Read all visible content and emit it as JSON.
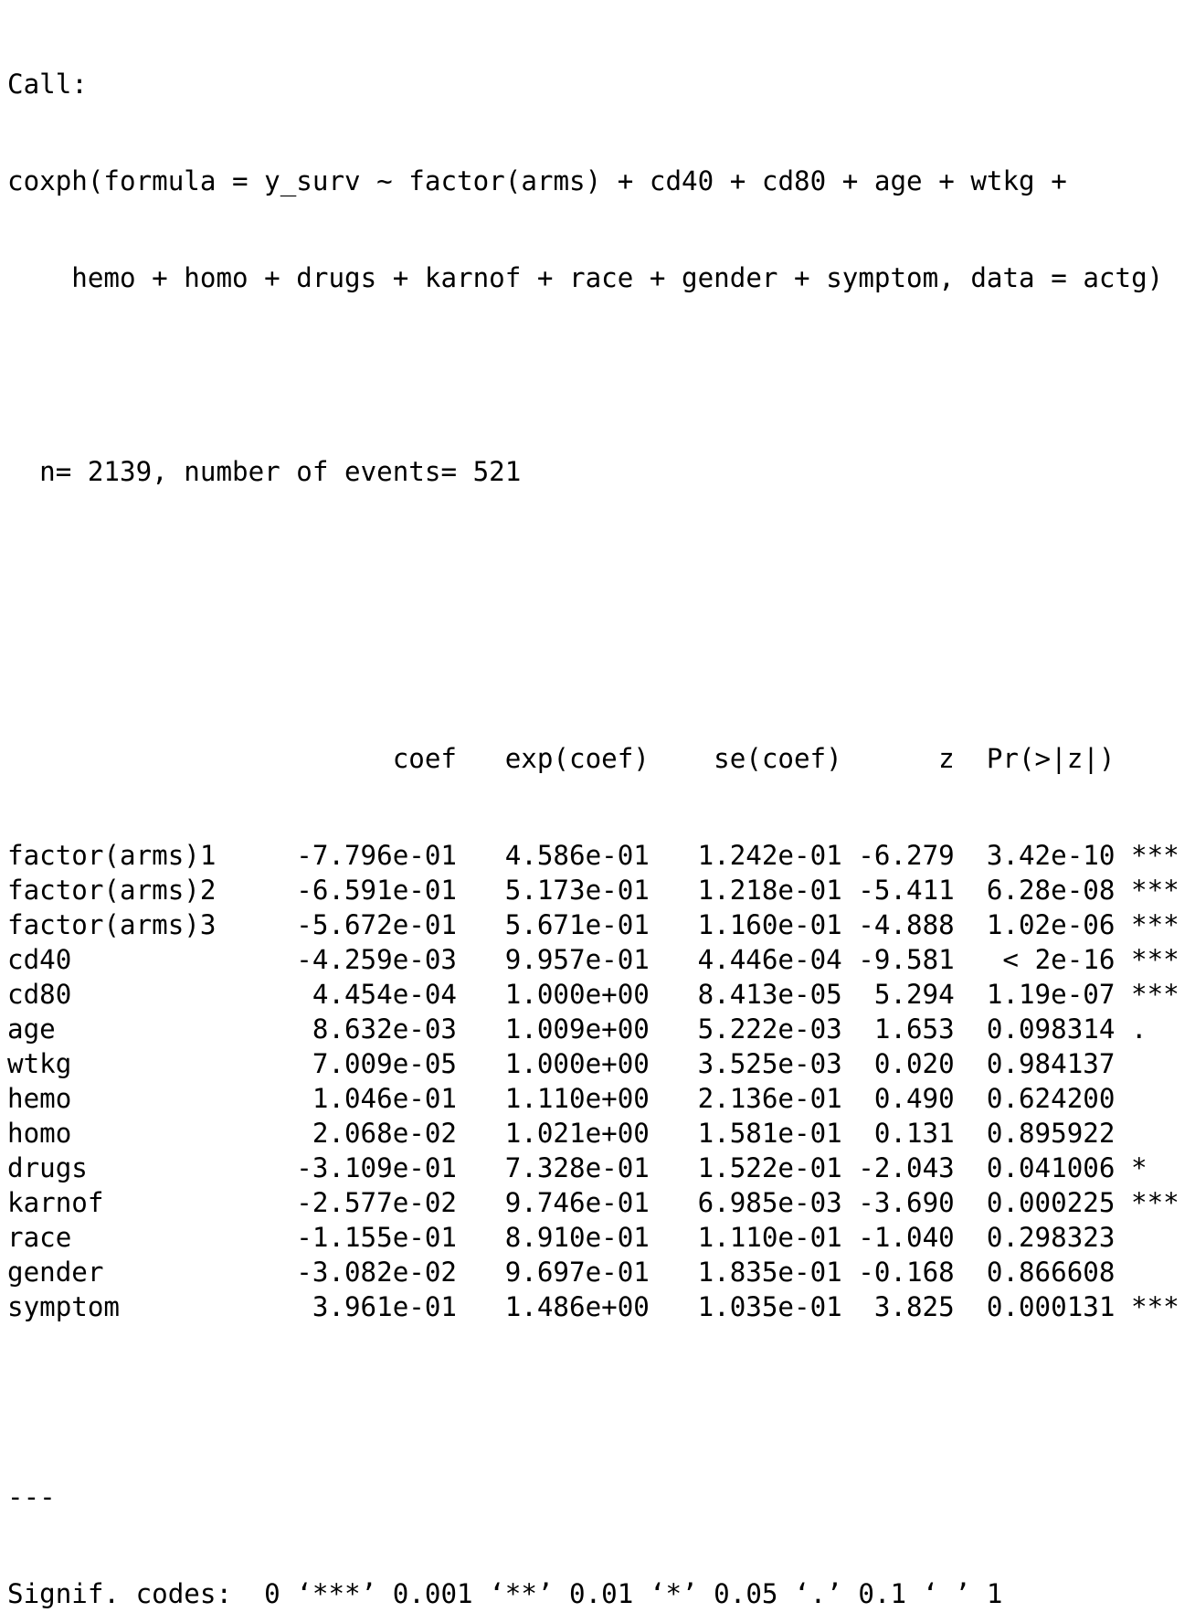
{
  "call": {
    "label": "Call:",
    "formula_line1": "coxph(formula = y_surv ~ factor(arms) + cd40 + cd80 + age + wtkg +",
    "formula_line2": "    hemo + homo + drugs + karnof + race + gender + symptom, data = actg)"
  },
  "summary": {
    "n_line": "  n= 2139, number of events= 521"
  },
  "table": {
    "headers": {
      "name": "",
      "coef": "coef",
      "exp_coef": "exp(coef)",
      "se_coef": "se(coef)",
      "z": "z",
      "p": "Pr(>|z|)",
      "sig": ""
    },
    "rows": [
      {
        "name": "factor(arms)1",
        "coef": "-7.796e-01",
        "exp_coef": "4.586e-01",
        "se_coef": "1.242e-01",
        "z": "-6.279",
        "p": "3.42e-10",
        "sig": "***"
      },
      {
        "name": "factor(arms)2",
        "coef": "-6.591e-01",
        "exp_coef": "5.173e-01",
        "se_coef": "1.218e-01",
        "z": "-5.411",
        "p": "6.28e-08",
        "sig": "***"
      },
      {
        "name": "factor(arms)3",
        "coef": "-5.672e-01",
        "exp_coef": "5.671e-01",
        "se_coef": "1.160e-01",
        "z": "-4.888",
        "p": "1.02e-06",
        "sig": "***"
      },
      {
        "name": "cd40",
        "coef": "-4.259e-03",
        "exp_coef": "9.957e-01",
        "se_coef": "4.446e-04",
        "z": "-9.581",
        "p": "< 2e-16",
        "sig": "***"
      },
      {
        "name": "cd80",
        "coef": "4.454e-04",
        "exp_coef": "1.000e+00",
        "se_coef": "8.413e-05",
        "z": "5.294",
        "p": "1.19e-07",
        "sig": "***"
      },
      {
        "name": "age",
        "coef": "8.632e-03",
        "exp_coef": "1.009e+00",
        "se_coef": "5.222e-03",
        "z": "1.653",
        "p": "0.098314",
        "sig": "."
      },
      {
        "name": "wtkg",
        "coef": "7.009e-05",
        "exp_coef": "1.000e+00",
        "se_coef": "3.525e-03",
        "z": "0.020",
        "p": "0.984137",
        "sig": ""
      },
      {
        "name": "hemo",
        "coef": "1.046e-01",
        "exp_coef": "1.110e+00",
        "se_coef": "2.136e-01",
        "z": "0.490",
        "p": "0.624200",
        "sig": ""
      },
      {
        "name": "homo",
        "coef": "2.068e-02",
        "exp_coef": "1.021e+00",
        "se_coef": "1.581e-01",
        "z": "0.131",
        "p": "0.895922",
        "sig": ""
      },
      {
        "name": "drugs",
        "coef": "-3.109e-01",
        "exp_coef": "7.328e-01",
        "se_coef": "1.522e-01",
        "z": "-2.043",
        "p": "0.041006",
        "sig": "*"
      },
      {
        "name": "karnof",
        "coef": "-2.577e-02",
        "exp_coef": "9.746e-01",
        "se_coef": "6.985e-03",
        "z": "-3.690",
        "p": "0.000225",
        "sig": "***"
      },
      {
        "name": "race",
        "coef": "-1.155e-01",
        "exp_coef": "8.910e-01",
        "se_coef": "1.110e-01",
        "z": "-1.040",
        "p": "0.298323",
        "sig": ""
      },
      {
        "name": "gender",
        "coef": "-3.082e-02",
        "exp_coef": "9.697e-01",
        "se_coef": "1.835e-01",
        "z": "-0.168",
        "p": "0.866608",
        "sig": ""
      },
      {
        "name": "symptom",
        "coef": "3.961e-01",
        "exp_coef": "1.486e+00",
        "se_coef": "1.035e-01",
        "z": "3.825",
        "p": "0.000131",
        "sig": "***"
      }
    ]
  },
  "footer": {
    "separator": "---",
    "signif_codes": "Signif. codes:  0 ‘***’ 0.001 ‘**’ 0.01 ‘*’ 0.05 ‘.’ 0.1 ‘ ’ 1"
  }
}
